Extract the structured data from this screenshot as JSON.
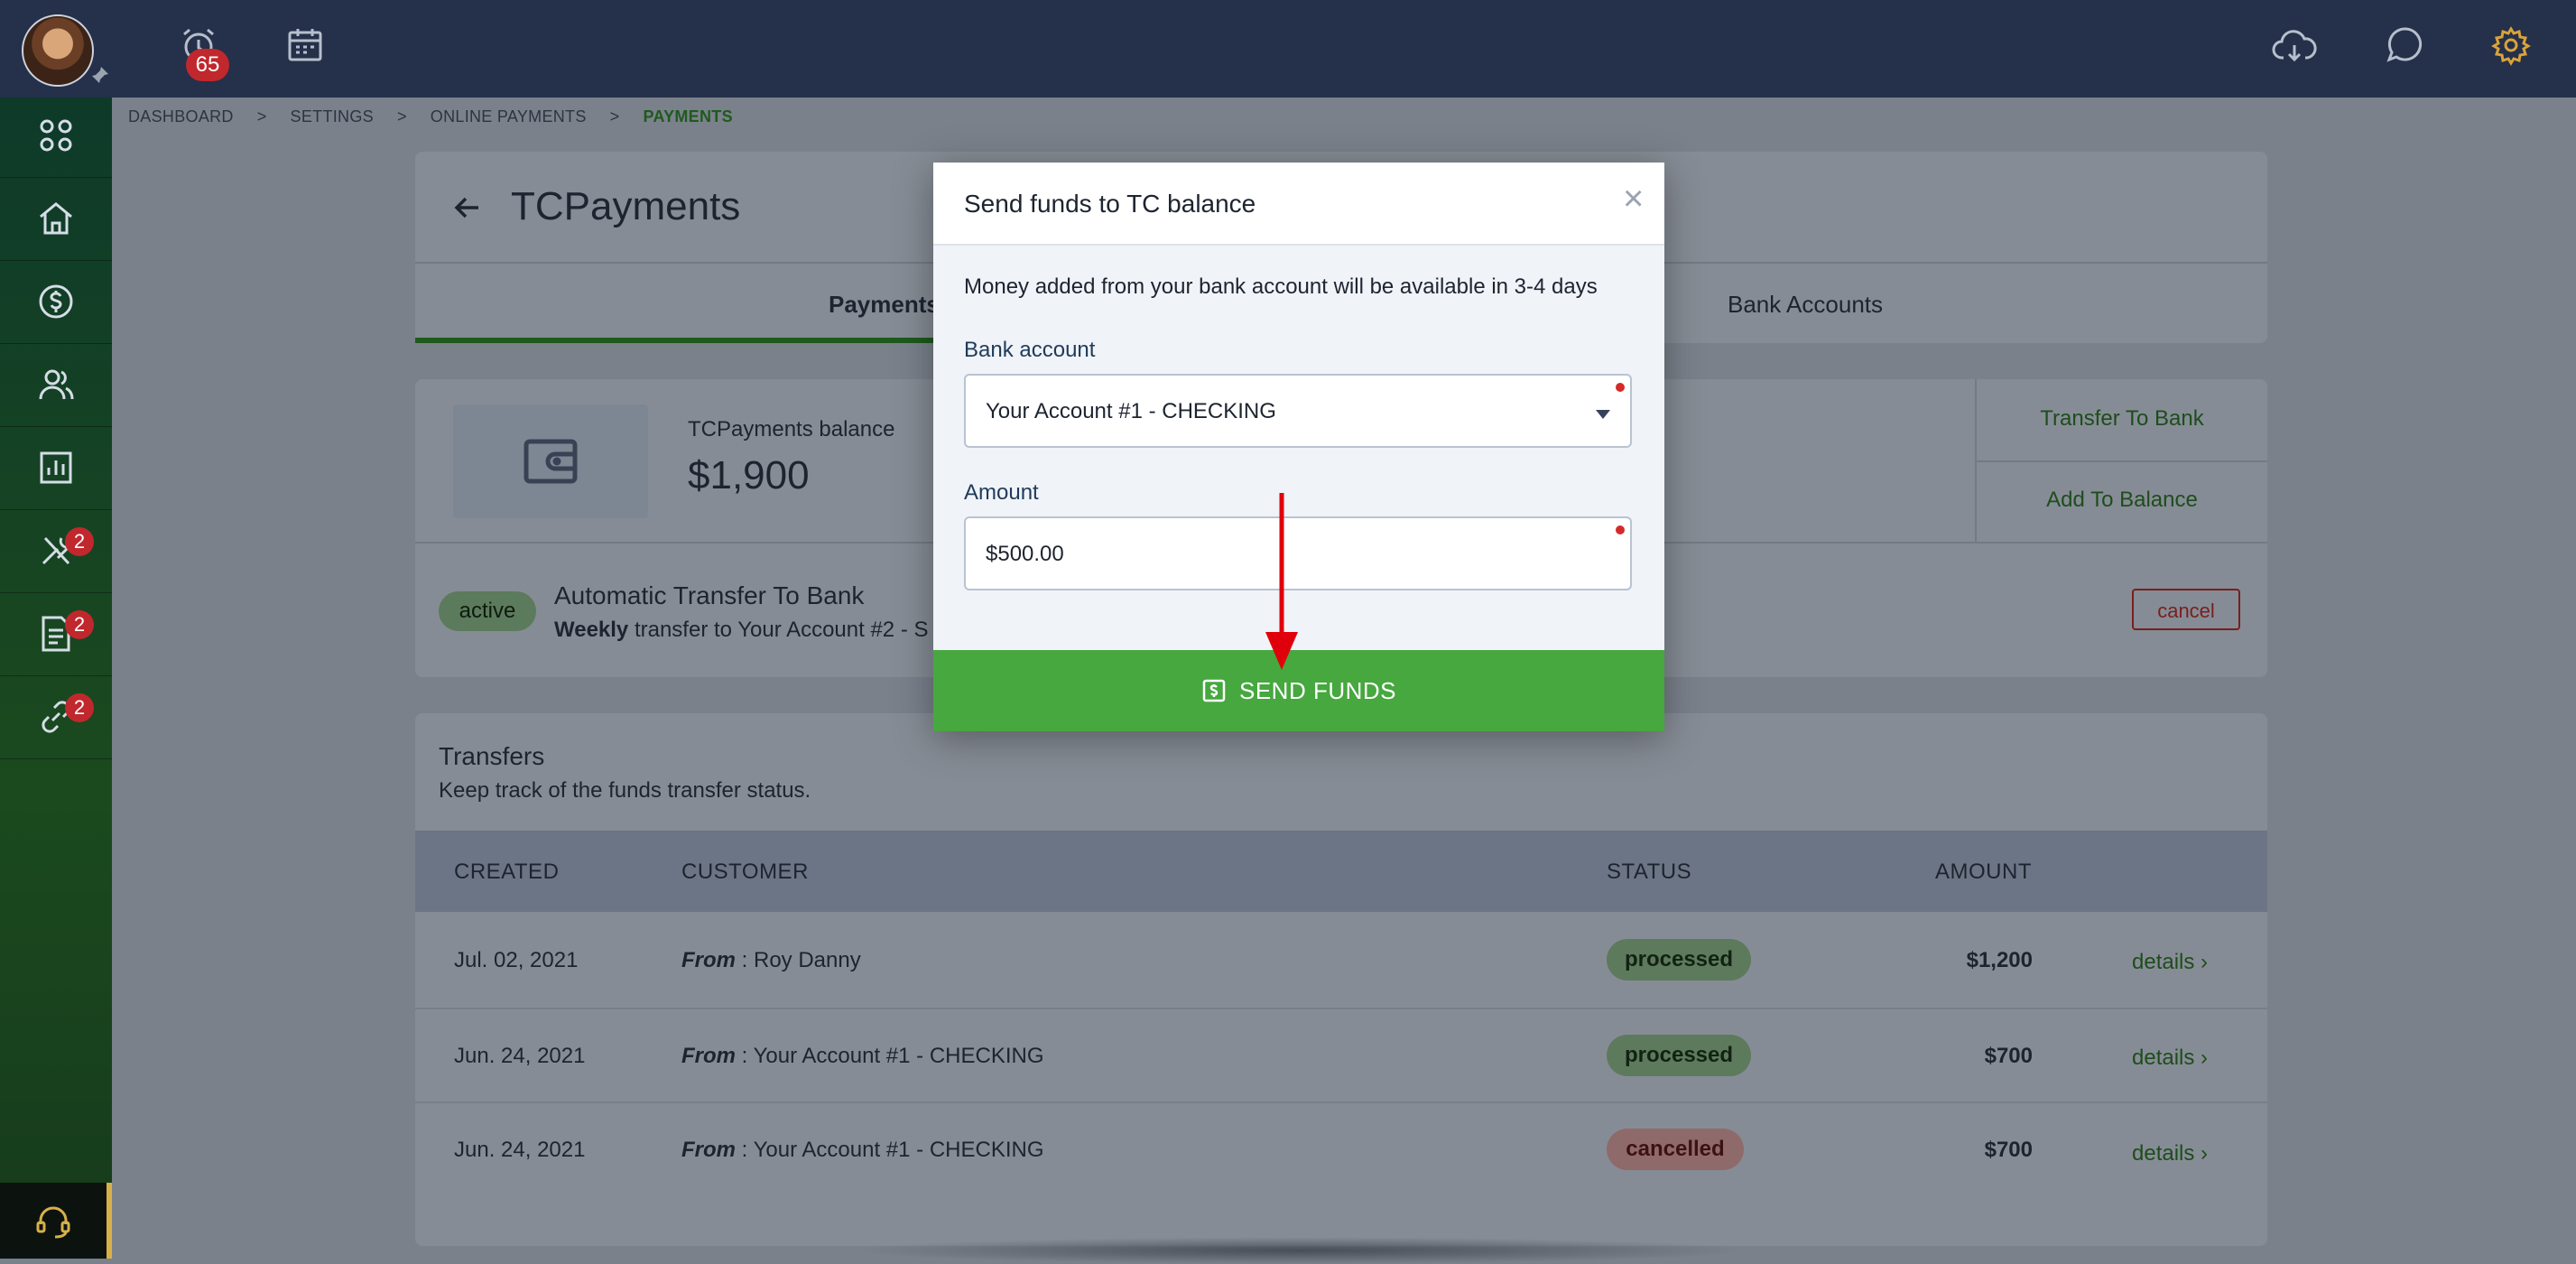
{
  "topbar": {
    "notification_count": "65",
    "icons": [
      "alarm-clock-icon",
      "calendar-icon",
      "cloud-download-icon",
      "chat-icon",
      "gear-icon"
    ]
  },
  "sidebar": {
    "items": [
      {
        "icon": "apps-grid-icon",
        "badge": ""
      },
      {
        "icon": "home-icon",
        "badge": ""
      },
      {
        "icon": "dollar-circle-icon",
        "badge": ""
      },
      {
        "icon": "users-icon",
        "badge": ""
      },
      {
        "icon": "bar-chart-icon",
        "badge": ""
      },
      {
        "icon": "tools-icon",
        "badge": "2"
      },
      {
        "icon": "document-icon",
        "badge": "2"
      },
      {
        "icon": "link-icon",
        "badge": "2"
      }
    ]
  },
  "breadcrumb": {
    "items": [
      "DASHBOARD",
      "SETTINGS",
      "ONLINE PAYMENTS",
      "PAYMENTS"
    ]
  },
  "page": {
    "title": "TCPayments",
    "tabs": [
      "Payments",
      "Bank Accounts"
    ]
  },
  "balance": {
    "label": "TCPayments balance",
    "value": "$1,900",
    "actions": [
      "Transfer To Bank",
      "Add To Balance"
    ]
  },
  "auto_transfer": {
    "status": "active",
    "title": "Automatic Transfer To Bank",
    "frequency": "Weekly",
    "description": "transfer to Your Account #2 - S",
    "cancel_label": "cancel"
  },
  "transfers": {
    "title": "Transfers",
    "subtitle": "Keep track of the funds transfer status.",
    "columns": [
      "CREATED",
      "CUSTOMER",
      "STATUS",
      "AMOUNT"
    ],
    "from_label": "From",
    "details_label": "details",
    "rows": [
      {
        "created": "Jul. 02, 2021",
        "customer": " : Roy Danny",
        "status": "processed",
        "amount": "$1,200"
      },
      {
        "created": "Jun. 24, 2021",
        "customer": " : Your Account #1 - CHECKING",
        "status": "processed",
        "amount": "$700"
      },
      {
        "created": "Jun. 24, 2021",
        "customer": " : Your Account #1 - CHECKING",
        "status": "cancelled",
        "amount": "$700"
      }
    ]
  },
  "modal": {
    "title": "Send funds to TC balance",
    "close": "×",
    "info": "Money added from your bank account will be available in 3-4 days",
    "bank_account_label": "Bank account",
    "bank_account_value": "Your Account #1 - CHECKING",
    "amount_label": "Amount",
    "amount_value": "$500.00",
    "submit_label": "SEND FUNDS"
  },
  "colors": {
    "primary_green": "#46a83f",
    "topbar": "#25304a",
    "annotation_arrow": "#e0000b",
    "badge_red": "#c0282d"
  }
}
